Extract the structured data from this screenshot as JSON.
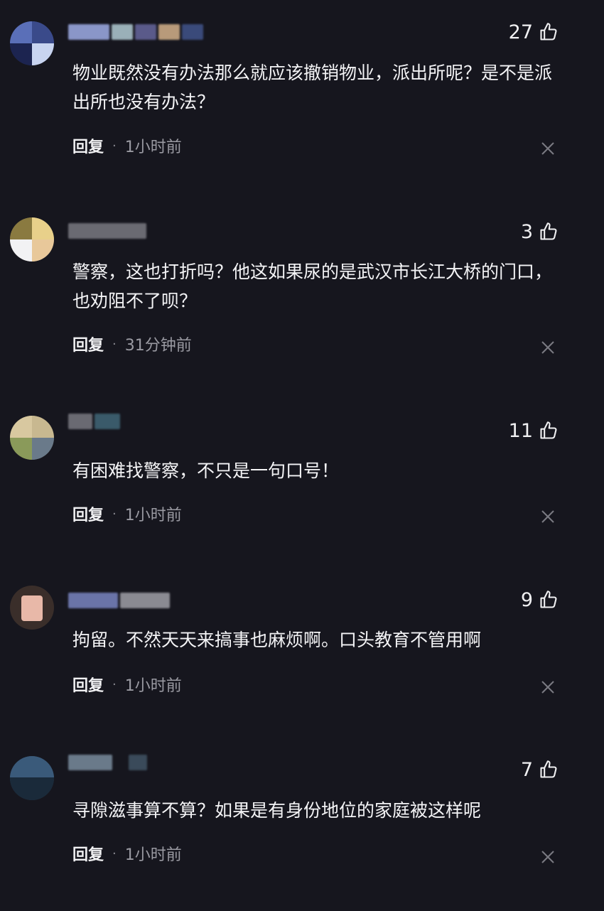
{
  "comments": [
    {
      "likes": "27",
      "text": "物业既然没有办法那么就应该撤销物业，派出所呢？是不是派出所也没有办法？",
      "reply": "回复",
      "time": "1小时前"
    },
    {
      "likes": "3",
      "text": "警察，这也打折吗？他这如果尿的是武汉市长江大桥的门口，也劝阻不了呗？",
      "reply": "回复",
      "time": "31分钟前"
    },
    {
      "likes": "11",
      "text": "有困难找警察，不只是一句口号！",
      "reply": "回复",
      "time": "1小时前"
    },
    {
      "likes": "9",
      "text": "拘留。不然天天来搞事也麻烦啊。口头教育不管用啊",
      "reply": "回复",
      "time": "1小时前"
    },
    {
      "likes": "7",
      "text": "寻隙滋事算不算？如果是有身份地位的家庭被这样呢",
      "reply": "回复",
      "time": "1小时前"
    }
  ],
  "colors": {
    "background": "#16161e",
    "text": "#f4f4f6",
    "muted": "#9a9aa2"
  }
}
